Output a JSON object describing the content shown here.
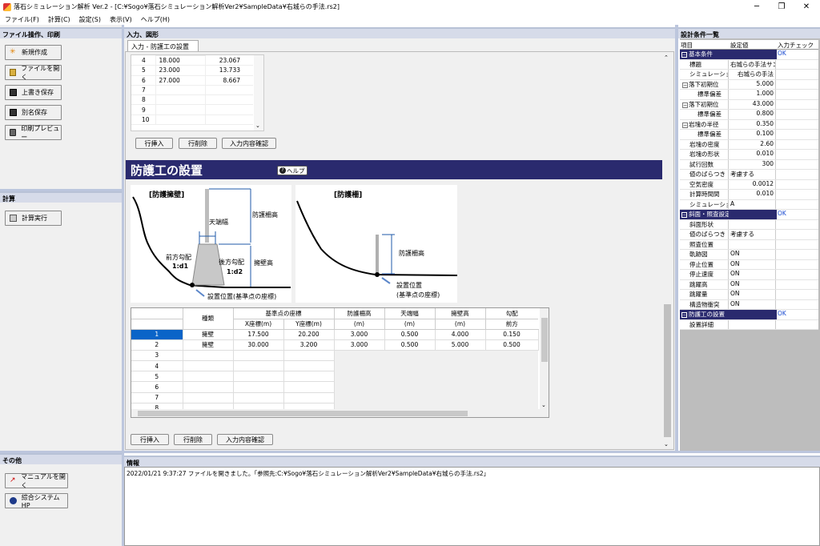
{
  "title_bar": {
    "title": "落石シミュレーション解析 Ver.2 - [C:¥Sogo¥落石シミュレーション解析Ver2¥SampleData¥右城らの手法.rs2]"
  },
  "menu": [
    "ファイル(F)",
    "計算(C)",
    "設定(S)",
    "表示(V)",
    "ヘルプ(H)"
  ],
  "left": {
    "file_panel_title": "ファイル操作、印刷",
    "file_buttons": [
      "新規作成",
      "ファイルを開く",
      "上書き保存",
      "別名保存",
      "印刷プレビュー"
    ],
    "calc_panel_title": "計算",
    "calc_button": "計算実行",
    "other_panel_title": "その他",
    "other_buttons": [
      "マニュアルを開く",
      "綜合システムHP"
    ]
  },
  "main": {
    "panel_title": "入力、図形",
    "tab": "入力 - 防護工の設置",
    "top_table": [
      {
        "n": "4",
        "a": "18.000",
        "b": "23.067"
      },
      {
        "n": "5",
        "a": "23.000",
        "b": "13.733"
      },
      {
        "n": "6",
        "a": "27.000",
        "b": "8.667"
      },
      {
        "n": "7",
        "a": "",
        "b": ""
      },
      {
        "n": "8",
        "a": "",
        "b": ""
      },
      {
        "n": "9",
        "a": "",
        "b": ""
      },
      {
        "n": "10",
        "a": "",
        "b": ""
      }
    ],
    "row_buttons": [
      "行挿入",
      "行削除",
      "入力内容確認"
    ],
    "section_title": "防護工の設置",
    "help_label": "ヘルプ",
    "diagram1": {
      "title": "[防護擁壁]",
      "top_width": "天端幅",
      "fence_height": "防護柵高",
      "front_slope": "前方勾配",
      "front_ratio": "1:d1",
      "back_slope": "後方勾配",
      "back_ratio": "1:d2",
      "wall_height": "擁壁高",
      "install": "設置位置(基準点の座標)"
    },
    "diagram2": {
      "title": "[防護柵]",
      "fence_height": "防護柵高",
      "install_1": "設置位置",
      "install_2": "(基準点の座標)"
    },
    "grid": {
      "h_type": "種類",
      "h_coord": "基準点の座標",
      "h_x": "X座標(m)",
      "h_y": "Y座標(m)",
      "h_fence": "防護柵高",
      "h_top": "天端幅",
      "h_wall": "擁壁高",
      "h_slope": "勾配",
      "h_front": "前方",
      "unit": "(m)",
      "rows": [
        {
          "n": "1",
          "type": "擁壁",
          "x": "17.500",
          "y": "20.200",
          "fence": "3.000",
          "top": "0.500",
          "wall": "4.000",
          "front": "0.150"
        },
        {
          "n": "2",
          "type": "擁壁",
          "x": "30.000",
          "y": "3.200",
          "fence": "3.000",
          "top": "0.500",
          "wall": "5.000",
          "front": "0.500"
        },
        {
          "n": "3"
        },
        {
          "n": "4"
        },
        {
          "n": "5"
        },
        {
          "n": "6"
        },
        {
          "n": "7"
        },
        {
          "n": "8"
        }
      ]
    }
  },
  "info": {
    "panel_title": "情報",
    "log": "2022/01/21 9:37:27 ファイルを開きました。「参照先:C:¥Sogo¥落石シミュレーション解析Ver2¥SampleData¥右城らの手法.rs2」"
  },
  "right": {
    "panel_title": "設計条件一覧",
    "headers": [
      "項目",
      "設定値",
      "入力チェック"
    ],
    "rows": [
      {
        "kind": "cat",
        "label": "基本条件",
        "check": "OK"
      },
      {
        "kind": "item",
        "indent": 1,
        "label": "標題",
        "value": "右城らの手法サン"
      },
      {
        "kind": "item",
        "indent": 1,
        "label": "シミュレーショ",
        "value": "右城らの手法"
      },
      {
        "kind": "sub",
        "indent": 1,
        "label": "落下初期位",
        "value": "5.000"
      },
      {
        "kind": "item",
        "indent": 2,
        "label": "標準偏差",
        "value": "1.000"
      },
      {
        "kind": "sub",
        "indent": 1,
        "label": "落下初期位",
        "value": "43.000"
      },
      {
        "kind": "item",
        "indent": 2,
        "label": "標準偏差",
        "value": "0.800"
      },
      {
        "kind": "sub",
        "indent": 1,
        "label": "岩塊の半径",
        "value": "0.350"
      },
      {
        "kind": "item",
        "indent": 2,
        "label": "標準偏差",
        "value": "0.100"
      },
      {
        "kind": "item",
        "indent": 1,
        "label": "岩塊の密度",
        "value": "2.60"
      },
      {
        "kind": "item",
        "indent": 1,
        "label": "岩塊の形状",
        "value": "0.010"
      },
      {
        "kind": "item",
        "indent": 1,
        "label": "試行回数",
        "value": "300"
      },
      {
        "kind": "item",
        "indent": 1,
        "label": "値のばらつき",
        "value": "考慮する",
        "left": true
      },
      {
        "kind": "item",
        "indent": 1,
        "label": "空気密度",
        "value": "0.0012"
      },
      {
        "kind": "item",
        "indent": 1,
        "label": "計算時間間",
        "value": "0.010"
      },
      {
        "kind": "item",
        "indent": 1,
        "label": "シミュレーショ",
        "value": "A",
        "left": true
      },
      {
        "kind": "cat",
        "label": "斜面・照査設定",
        "check": "OK"
      },
      {
        "kind": "item",
        "indent": 1,
        "label": "斜面形状",
        "value": ""
      },
      {
        "kind": "item",
        "indent": 1,
        "label": "値のばらつき",
        "value": "考慮する",
        "left": true
      },
      {
        "kind": "item",
        "indent": 1,
        "label": "照査位置",
        "value": ""
      },
      {
        "kind": "item",
        "indent": 1,
        "label": "軌跡図",
        "value": "ON",
        "left": true
      },
      {
        "kind": "item",
        "indent": 1,
        "label": "停止位置",
        "value": "ON",
        "left": true
      },
      {
        "kind": "item",
        "indent": 1,
        "label": "停止速度",
        "value": "ON",
        "left": true
      },
      {
        "kind": "item",
        "indent": 1,
        "label": "跳躍高",
        "value": "ON",
        "left": true
      },
      {
        "kind": "item",
        "indent": 1,
        "label": "跳躍量",
        "value": "ON",
        "left": true
      },
      {
        "kind": "item",
        "indent": 1,
        "label": "構造物衝突",
        "value": "ON",
        "left": true
      },
      {
        "kind": "cat",
        "label": "防護工の設置",
        "check": "OK"
      },
      {
        "kind": "item",
        "indent": 1,
        "label": "設置詳細",
        "value": ""
      }
    ]
  }
}
